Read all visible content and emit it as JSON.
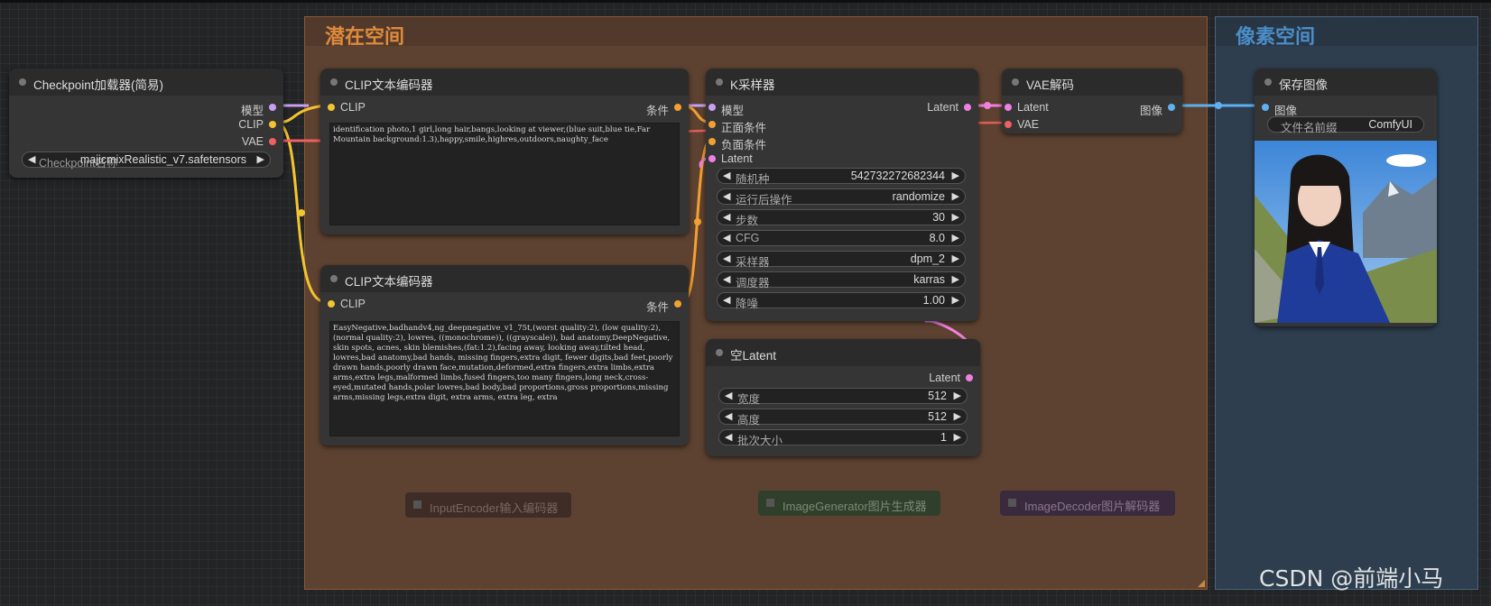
{
  "groups": {
    "latent_title": "潜在空间",
    "pixel_title": "像素空间"
  },
  "checkpoint": {
    "title": "Checkpoint加载器(简易)",
    "outputs": [
      "模型",
      "CLIP",
      "VAE"
    ],
    "ckpt_label": "Checkpoint名称",
    "ckpt_value": "majicmixRealistic_v7.safetensors"
  },
  "clip_pos": {
    "title": "CLIP文本编码器",
    "input": "CLIP",
    "output": "条件",
    "text": "identification photo,1 girl,long hair,bangs,looking at viewer,(blue suit,blue tie,Far Mountain background:1.3),happy,smile,highres,outdoors,naughty_face"
  },
  "clip_neg": {
    "title": "CLIP文本编码器",
    "input": "CLIP",
    "output": "条件",
    "text": "EasyNegative,badhandv4,ng_deepnegative_v1_75t,(worst quality:2), (low quality:2), (normal quality:2), lowres, ((monochrome)), ((grayscale)), bad anatomy,DeepNegative, skin spots, acnes, skin blemishes,(fat:1.2),facing away, looking away,tilted head, lowres,bad anatomy,bad hands, missing fingers,extra digit, fewer digits,bad feet,poorly drawn hands,poorly drawn face,mutation,deformed,extra fingers,extra limbs,extra arms,extra legs,malformed limbs,fused fingers,too many fingers,long neck,cross-eyed,mutated hands,polar lowres,bad body,bad proportions,gross proportions,missing arms,missing legs,extra digit, extra arms, extra leg, extra"
  },
  "ksampler": {
    "title": "K采样器",
    "inputs": [
      "模型",
      "正面条件",
      "负面条件",
      "Latent"
    ],
    "output": "Latent",
    "widgets": [
      {
        "label": "随机种",
        "value": "542732272682344"
      },
      {
        "label": "运行后操作",
        "value": "randomize"
      },
      {
        "label": "步数",
        "value": "30"
      },
      {
        "label": "CFG",
        "value": "8.0"
      },
      {
        "label": "采样器",
        "value": "dpm_2"
      },
      {
        "label": "调度器",
        "value": "karras"
      },
      {
        "label": "降噪",
        "value": "1.00"
      }
    ]
  },
  "empty_latent": {
    "title": "空Latent",
    "output": "Latent",
    "widgets": [
      {
        "label": "宽度",
        "value": "512"
      },
      {
        "label": "高度",
        "value": "512"
      },
      {
        "label": "批次大小",
        "value": "1"
      }
    ]
  },
  "vae_decode": {
    "title": "VAE解码",
    "inputs": [
      "Latent",
      "VAE"
    ],
    "output": "图像"
  },
  "save_image": {
    "title": "保存图像",
    "input": "图像",
    "prefix_label": "文件名前缀",
    "prefix_value": "ComfyUI"
  },
  "placeholders": {
    "input_encoder": "InputEncoder输入编码器",
    "image_generator": "ImageGenerator图片生成器",
    "image_decoder": "ImageDecoder图片解码器"
  },
  "watermark": "CSDN @前端小马",
  "colors": {
    "latent_group": "#5d4231",
    "pixel_group": "#2e3e4e",
    "clip_wire": "#f4c430",
    "model_wire": "#c9a0f0",
    "vae_wire": "#f06060",
    "cond_wire": "#f4a030",
    "latent_wire": "#f080e0",
    "image_wire": "#60b0f0"
  }
}
